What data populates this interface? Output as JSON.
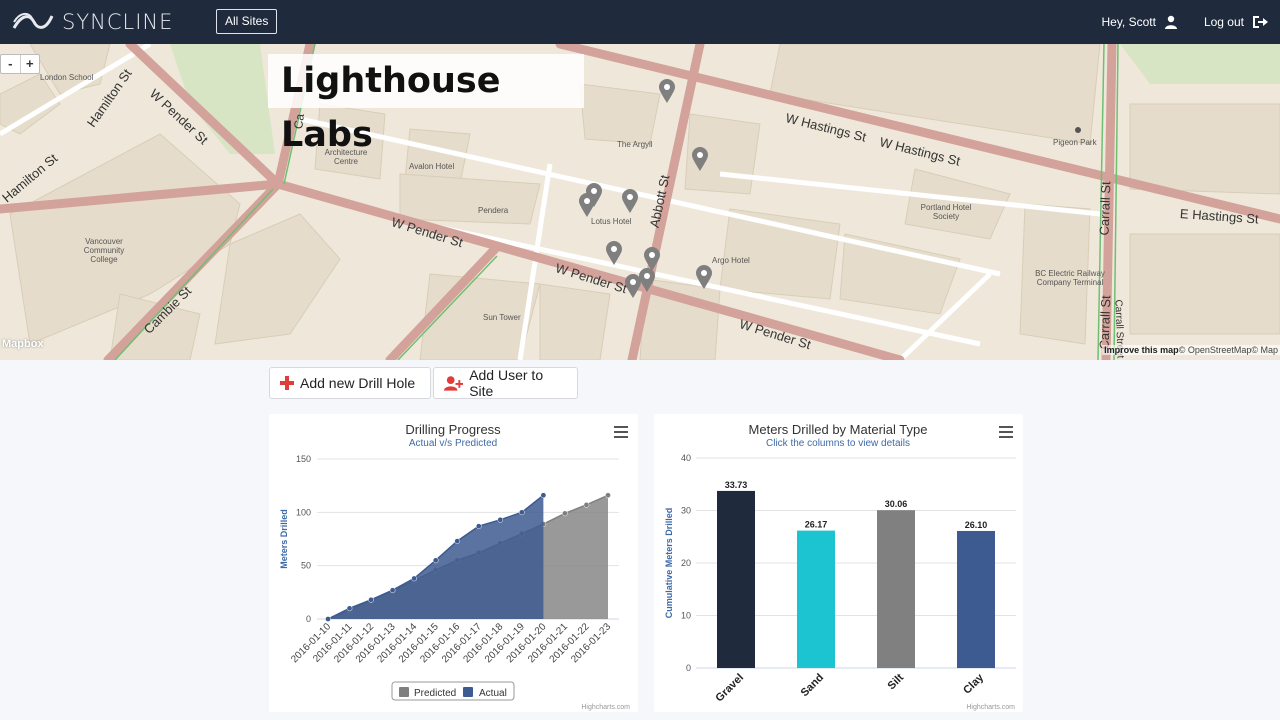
{
  "nav": {
    "brand": "SYNCLINE",
    "all_sites_label": "All Sites",
    "greeting": "Hey, Scott",
    "logout_label": "Log out"
  },
  "map": {
    "site_title": "Lighthouse Labs",
    "zoom_in": "+",
    "zoom_out": "-",
    "mapbox_label": "Mapbox",
    "attribution_improve": "Improve this map",
    "attribution_rest": "© OpenStreetMap© Map",
    "places": {
      "london_school": "London School",
      "architecture_centre": "Architecture Centre",
      "avalon_hotel": "Avalon Hotel",
      "the_argyll": "The Argyll",
      "pendera": "Pendera",
      "lotus_hotel": "Lotus Hotel",
      "argo_hotel": "Argo Hotel",
      "vcc": "Vancouver Community College",
      "sun_tower": "Sun Tower",
      "portland_hotel": "Portland Hotel Society",
      "pigeon_park": "Pigeon Park",
      "bc_electric": "BC Electric Railway Company Terminal"
    },
    "streets": {
      "w_pender_1": "W Pender St",
      "w_pender_2": "W Pender St",
      "w_pender_3": "W Pender St",
      "w_pender_4": "W Pender St",
      "w_hastings_1": "W Hastings St",
      "w_hastings_2": "W Hastings St",
      "e_hastings": "E Hastings St",
      "hamilton_1": "Hamilton St",
      "hamilton_2": "Hamilton St",
      "cambie": "Cambie St",
      "abbott": "Abbott St",
      "carrall_1": "Carrall St",
      "carrall_2": "Carrall St",
      "carrall_3": "Carrall Street",
      "ca": "Ca"
    },
    "pin_color": "#7f7f7f"
  },
  "actions": {
    "add_drill_hole": "Add new Drill Hole",
    "add_user": "Add User to Site"
  },
  "colors": {
    "navbar": "#1f2a3d",
    "actual": "#3d5a91",
    "predicted": "#7f7f7f",
    "gravel": "#1f2a3d",
    "sand": "#1cc3d0",
    "silt": "#808080",
    "clay": "#3d5a91",
    "add_icon": "#e03c3c"
  },
  "charts": {
    "progress": {
      "title": "Drilling Progress",
      "subtitle": "Actual v/s Predicted",
      "credits": "Highcharts.com"
    },
    "material": {
      "title": "Meters Drilled by Material Type",
      "subtitle": "Click the columns to view details",
      "credits": "Highcharts.com"
    }
  },
  "chart_data": [
    {
      "type": "area",
      "title": "Drilling Progress",
      "subtitle": "Actual v/s Predicted",
      "ylabel": "Meters Drilled",
      "xlabel": "",
      "ylim": [
        0,
        150
      ],
      "yticks": [
        0,
        50,
        100,
        150
      ],
      "categories": [
        "2016-01-10",
        "2016-01-11",
        "2016-01-12",
        "2016-01-13",
        "2016-01-14",
        "2016-01-15",
        "2016-01-16",
        "2016-01-17",
        "2016-01-18",
        "2016-01-19",
        "2016-01-20",
        "2016-01-21",
        "2016-01-22",
        "2016-01-23"
      ],
      "series": [
        {
          "name": "Predicted",
          "values": [
            0,
            8,
            18,
            26,
            36,
            46,
            55,
            62,
            71,
            80,
            89,
            99,
            107,
            116
          ]
        },
        {
          "name": "Actual",
          "values": [
            0,
            10,
            18,
            27,
            38,
            55,
            73,
            87,
            93,
            100,
            116,
            null,
            null,
            null
          ]
        }
      ],
      "legend": "bottom-center",
      "grid": true
    },
    {
      "type": "bar",
      "title": "Meters Drilled by Material Type",
      "subtitle": "Click the columns to view details",
      "ylabel": "Cumulative Meters Drilled",
      "xlabel": "",
      "ylim": [
        0,
        40
      ],
      "yticks": [
        0,
        10,
        20,
        30,
        40
      ],
      "categories": [
        "Gravel",
        "Sand",
        "Silt",
        "Clay"
      ],
      "values": [
        33.73,
        26.17,
        30.06,
        26.1
      ],
      "data_labels": [
        "33.73",
        "26.17",
        "30.06",
        "26.10"
      ],
      "grid": true
    }
  ]
}
